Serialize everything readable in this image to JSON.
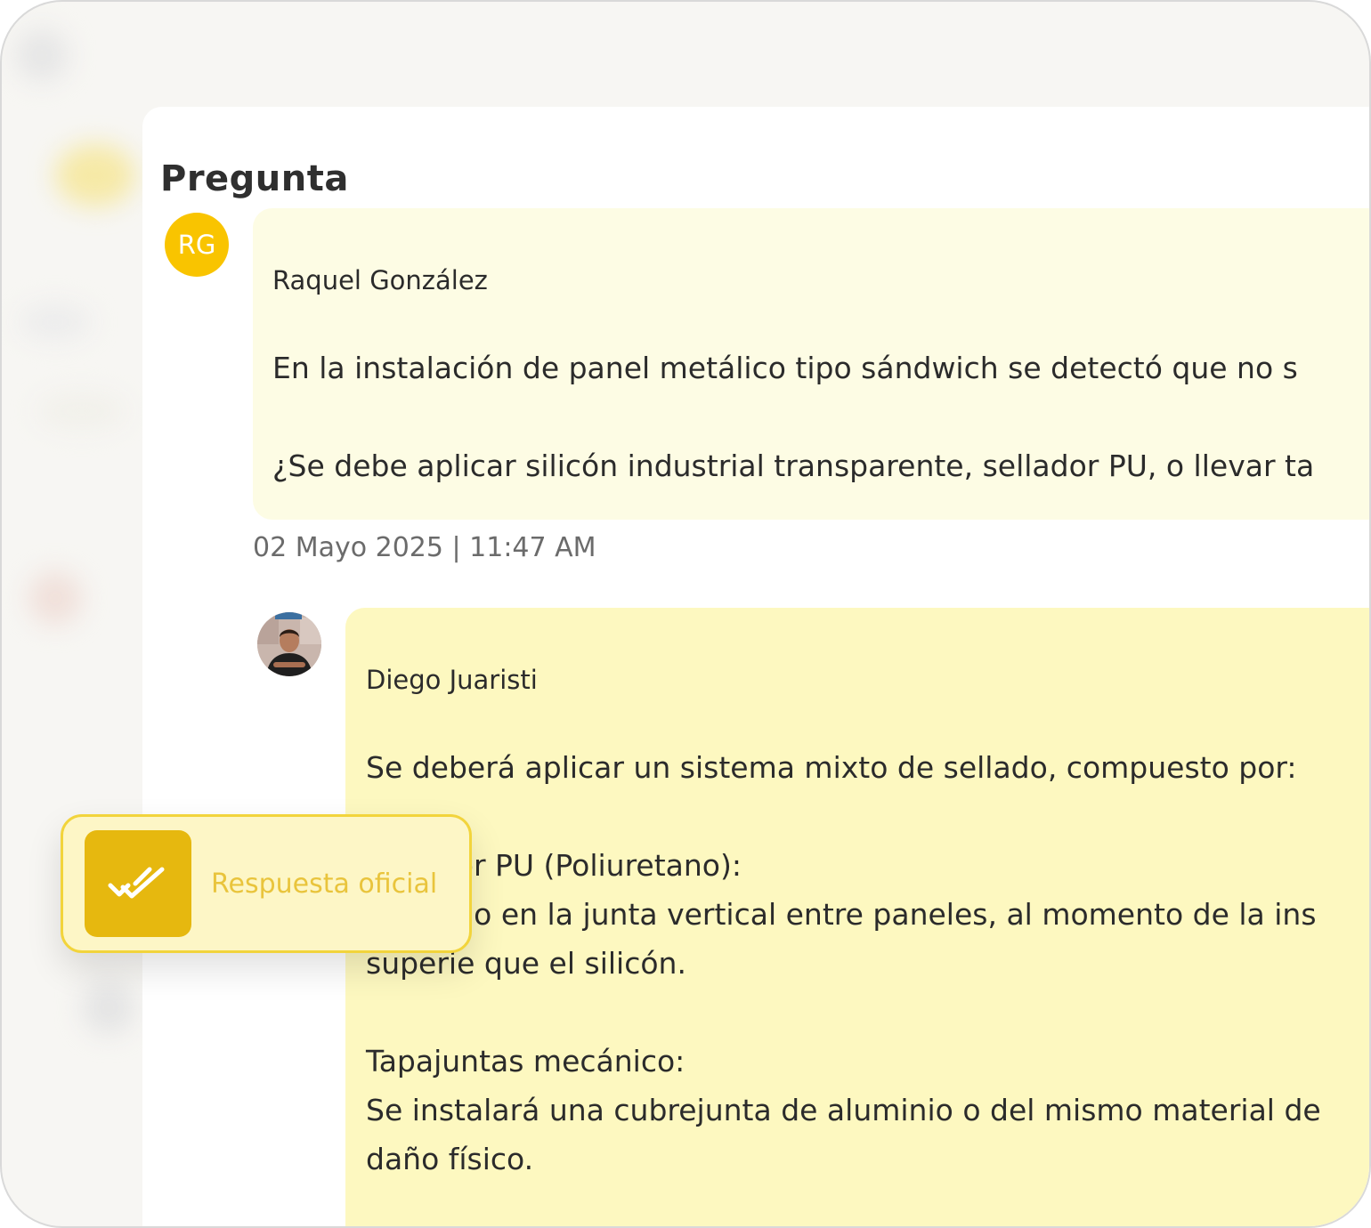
{
  "question": {
    "section_title": "Pregunta",
    "author": {
      "initials": "RG",
      "name": "Raquel González"
    },
    "message": "En la instalación de panel metálico tipo sándwich se detectó que no s\n\n¿Se debe aplicar silicón industrial transparente, sellador PU, o llevar ta",
    "timestamp": "02 Mayo 2025 | 11:47 AM"
  },
  "answer": {
    "author": {
      "name": "Diego Juaristi",
      "avatar_icon": "user-photo"
    },
    "message": "Se deberá aplicar un sistema mixto de sellado, compuesto por:\n\nSellador PU (Poliuretano):\nAplicado en la junta vertical entre paneles, al momento de la ins\nsuperie que el silicón.\n\nTapajuntas mecánico:\nSe instalará una cubrejunta de aluminio o del mismo material de\ndaño físico."
  },
  "official_badge": {
    "label": "Respuesta oficial",
    "icon": "double-check-icon"
  },
  "colors": {
    "accent": "#f9c400",
    "question_bubble": "#fdfce4",
    "answer_bubble": "#fdf8c0",
    "badge_icon_bg": "#e6b80f",
    "badge_text": "#e9c43c"
  }
}
